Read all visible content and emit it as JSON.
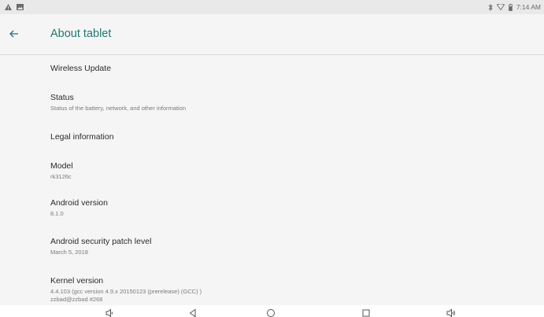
{
  "status_bar": {
    "time": "7:14 AM",
    "left_icons": [
      "warning-icon",
      "image-notification-icon"
    ],
    "right_icons": [
      "bluetooth-icon",
      "wifi-icon",
      "battery-icon"
    ]
  },
  "app_bar": {
    "back_icon": "back-arrow-icon",
    "title": "About tablet",
    "accent_color": "#1f7a72"
  },
  "items": [
    {
      "key": "wireless_update",
      "title": "Wireless Update",
      "summary": ""
    },
    {
      "key": "status",
      "title": "Status",
      "summary": "Status of the battery, network, and other information"
    },
    {
      "key": "legal",
      "title": "Legal information",
      "summary": ""
    },
    {
      "key": "model",
      "title": "Model",
      "summary": "rk3126c"
    },
    {
      "key": "android_version",
      "title": "Android version",
      "summary": "8.1.0"
    },
    {
      "key": "security_patch",
      "title": "Android security patch level",
      "summary": "March 5, 2018"
    },
    {
      "key": "kernel",
      "title": "Kernel version",
      "summary": "4.4.103 (gcc version 4.9.x 20150123 (prerelease) (GCC) )",
      "summary_line2": "zzbad@zzbad #268"
    }
  ],
  "nav_bar": {
    "buttons": [
      "volume-down-icon",
      "back-triangle-icon",
      "home-circle-icon",
      "recents-square-icon",
      "volume-up-icon"
    ]
  }
}
